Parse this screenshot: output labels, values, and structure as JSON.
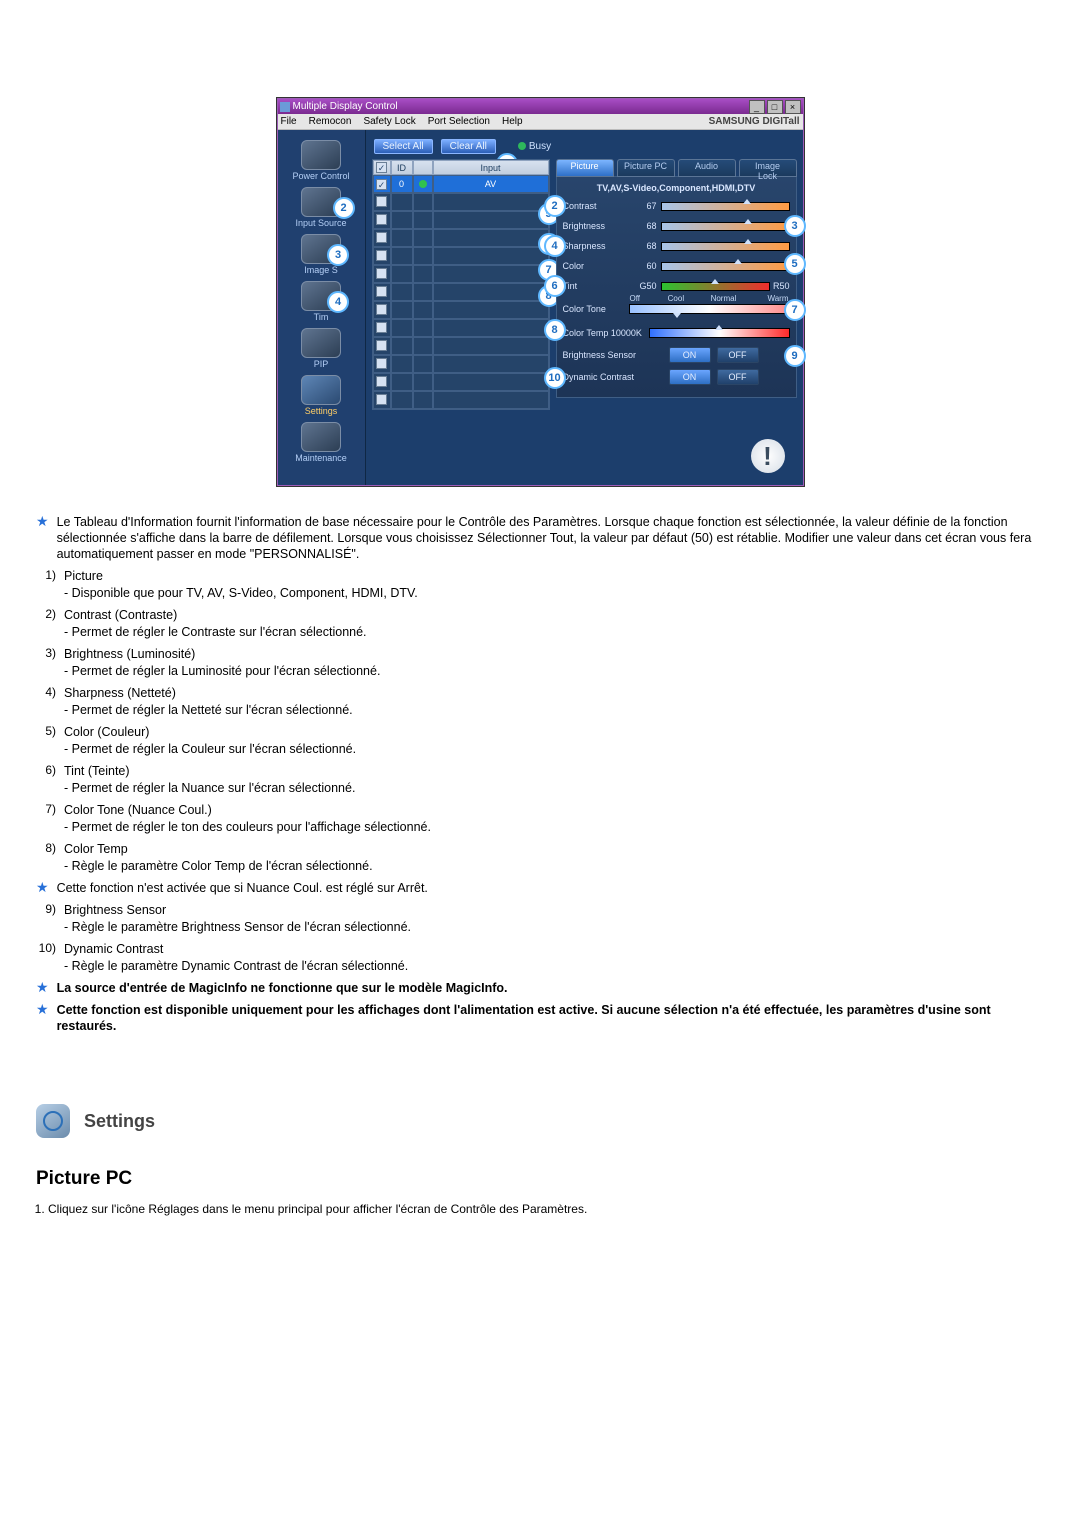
{
  "app": {
    "title": "Multiple Display Control",
    "menu": [
      "File",
      "Remocon",
      "Safety Lock",
      "Port Selection",
      "Help"
    ],
    "brand": "SAMSUNG DIGITall"
  },
  "sidebar": {
    "items": [
      {
        "label": "Power Control"
      },
      {
        "label": "Input Source",
        "badge": "2"
      },
      {
        "label": "Image S",
        "badge": "3"
      },
      {
        "label": "Tim",
        "badge": "4"
      },
      {
        "label": "PIP"
      },
      {
        "label": "Settings",
        "active": true
      },
      {
        "label": "Maintenance"
      }
    ]
  },
  "buttons": {
    "select_all": "Select All",
    "clear_all": "Clear All",
    "busy": "Busy"
  },
  "grid": {
    "headers": {
      "id": "ID",
      "input": "Input"
    },
    "rows": [
      {
        "checked": true,
        "id": "0",
        "dot": "g",
        "input": "AV"
      },
      {
        "checked": false,
        "id": "",
        "dot": "",
        "input": ""
      },
      {
        "checked": false,
        "id": "",
        "dot": "",
        "input": ""
      },
      {
        "checked": false,
        "id": "",
        "dot": "",
        "input": ""
      },
      {
        "checked": false,
        "id": "",
        "dot": "",
        "input": ""
      },
      {
        "checked": false,
        "id": "",
        "dot": "",
        "input": ""
      },
      {
        "checked": false,
        "id": "",
        "dot": "",
        "input": ""
      },
      {
        "checked": false,
        "id": "",
        "dot": "",
        "input": ""
      },
      {
        "checked": false,
        "id": "",
        "dot": "",
        "input": ""
      },
      {
        "checked": false,
        "id": "",
        "dot": "",
        "input": ""
      },
      {
        "checked": false,
        "id": "",
        "dot": "",
        "input": ""
      },
      {
        "checked": false,
        "id": "",
        "dot": "",
        "input": ""
      },
      {
        "checked": false,
        "id": "",
        "dot": "",
        "input": ""
      }
    ]
  },
  "tabs": [
    "Picture",
    "Picture PC",
    "Audio",
    "Image Lock"
  ],
  "controls": {
    "sources": "TV,AV,S-Video,Component,HDMI,DTV",
    "contrast": {
      "label": "Contrast",
      "value": "67"
    },
    "brightness": {
      "label": "Brightness",
      "value": "68"
    },
    "sharpness": {
      "label": "Sharpness",
      "value": "68"
    },
    "color": {
      "label": "Color",
      "value": "60"
    },
    "tint": {
      "label": "Tint",
      "value": "G50",
      "right": "R50"
    },
    "color_tone": {
      "label": "Color Tone",
      "opts": [
        "Off",
        "Cool",
        "Normal",
        "Warm"
      ]
    },
    "color_temp": {
      "label": "Color Temp 10000K"
    },
    "brightness_sensor": {
      "label": "Brightness Sensor",
      "on": "ON",
      "off": "OFF"
    },
    "dynamic": {
      "label": "Dynamic Contrast",
      "on": "ON",
      "off": "OFF"
    }
  },
  "callouts": {
    "left": {
      "5": "5",
      "6": "6",
      "7": "7",
      "8": "8"
    },
    "top": "1",
    "right": {
      "2": "2",
      "4": "4",
      "6": "6",
      "8": "8",
      "10": "10",
      "3": "3",
      "5": "5",
      "7": "7",
      "9": "9"
    }
  },
  "body": {
    "star1": "Le Tableau d'Information fournit l'information de base nécessaire pour le Contrôle des Paramètres. Lorsque chaque fonction est sélectionnée, la valeur définie de la fonction sélectionnée s'affiche dans la barre de défilement. Lorsque vous choisissez Sélectionner Tout, la valeur par défaut (50) est rétablie. Modifier une valeur dans cet écran vous fera automatiquement passer en mode \"PERSONNALISÉ\".",
    "items": [
      {
        "n": "1)",
        "t": "Picture",
        "d": "- Disponible que pour TV, AV, S-Video, Component, HDMI, DTV."
      },
      {
        "n": "2)",
        "t": "Contrast (Contraste)",
        "d": "- Permet de régler le Contraste sur l'écran sélectionné."
      },
      {
        "n": "3)",
        "t": "Brightness (Luminosité)",
        "d": "- Permet de régler la Luminosité pour l'écran sélectionné."
      },
      {
        "n": "4)",
        "t": "Sharpness (Netteté)",
        "d": "- Permet de régler la Netteté sur l'écran sélectionné."
      },
      {
        "n": "5)",
        "t": "Color (Couleur)",
        "d": "- Permet de régler la Couleur sur l'écran sélectionné."
      },
      {
        "n": "6)",
        "t": "Tint (Teinte)",
        "d": "- Permet de régler la Nuance sur l'écran sélectionné."
      },
      {
        "n": "7)",
        "t": "Color Tone (Nuance Coul.)",
        "d": "- Permet de régler le ton des couleurs pour l'affichage sélectionné."
      },
      {
        "n": "8)",
        "t": "Color Temp",
        "d": "- Règle le paramètre Color Temp de l'écran sélectionné."
      }
    ],
    "star2": "Cette fonction n'est activée que si Nuance Coul. est réglé sur Arrêt.",
    "items2": [
      {
        "n": "9)",
        "t": "Brightness Sensor",
        "d": "- Règle le paramètre Brightness Sensor de l'écran sélectionné."
      },
      {
        "n": "10)",
        "t": "Dynamic Contrast",
        "d": "- Règle le paramètre Dynamic Contrast de l'écran sélectionné."
      }
    ],
    "star3": "La source d'entrée de MagicInfo ne fonctionne que sur le modèle MagicInfo.",
    "star4": "Cette fonction est disponible uniquement pour les affichages dont l'alimentation est active. Si aucune sélection n'a été effectuée, les paramètres d'usine sont restaurés."
  },
  "section": {
    "heading": "Settings",
    "sub": "Picture PC",
    "list1": "Cliquez sur l'icône Réglages dans le menu principal pour afficher l'écran de Contrôle des Paramètres."
  }
}
